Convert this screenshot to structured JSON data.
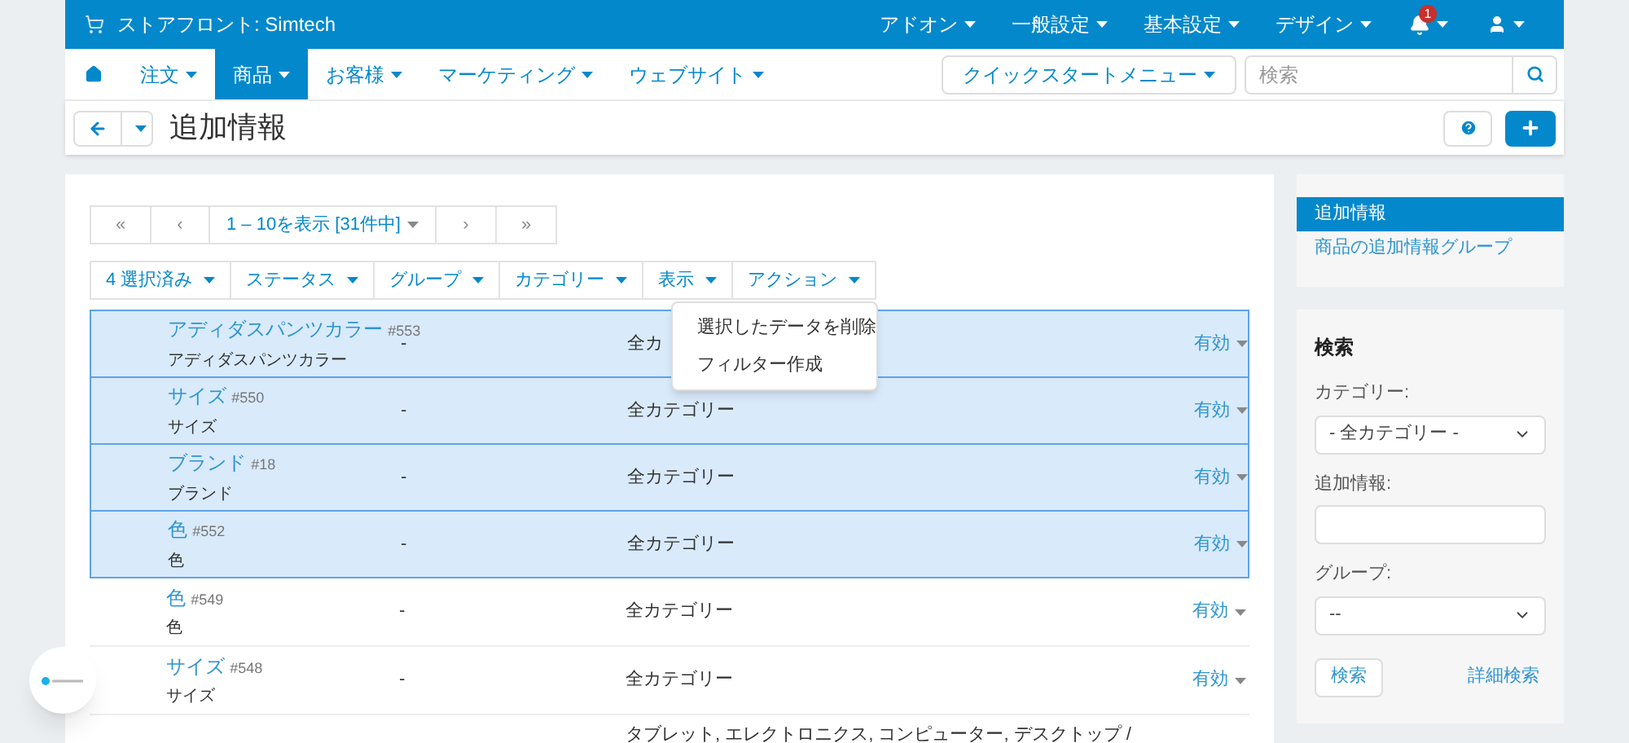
{
  "topbar": {
    "store": "ストアフロント: Simtech",
    "menus": [
      "アドオン",
      "一般設定",
      "基本設定",
      "デザイン"
    ],
    "notification_count": "1"
  },
  "nav": {
    "tabs": [
      {
        "label": "注文",
        "selected": false
      },
      {
        "label": "商品",
        "selected": true
      },
      {
        "label": "お客様",
        "selected": false
      },
      {
        "label": "マーケティング",
        "selected": false
      },
      {
        "label": "ウェブサイト",
        "selected": false
      }
    ],
    "quickstart": "クイックスタートメニュー",
    "search": {
      "placeholder": "検索"
    }
  },
  "page_title": "追加情報",
  "pagination": {
    "first": "«",
    "prev": "‹",
    "range": "1 – 10を表示 [31件中]",
    "next": "›",
    "last": "»"
  },
  "filters": [
    "4 選択済み",
    "ステータス",
    "グループ",
    "カテゴリー",
    "表示",
    "アクション"
  ],
  "action_menu": [
    "選択したデータを削除",
    "フィルター作成"
  ],
  "rows": [
    {
      "name": "アディダスパンツカラー",
      "id": "#553",
      "sub": "アディダスパンツカラー",
      "group": "-",
      "category": "全カ",
      "status": "有効",
      "selected": true
    },
    {
      "name": "サイズ",
      "id": "#550",
      "sub": "サイズ",
      "group": "-",
      "category": "全カテゴリー",
      "status": "有効",
      "selected": true
    },
    {
      "name": "ブランド",
      "id": "#18",
      "sub": "ブランド",
      "group": "-",
      "category": "全カテゴリー",
      "status": "有効",
      "selected": true
    },
    {
      "name": "色",
      "id": "#552",
      "sub": "色",
      "group": "-",
      "category": "全カテゴリー",
      "status": "有効",
      "selected": true
    },
    {
      "name": "色",
      "id": "#549",
      "sub": "色",
      "group": "-",
      "category": "全カテゴリー",
      "status": "有効",
      "selected": false
    },
    {
      "name": "サイズ",
      "id": "#548",
      "sub": "サイズ",
      "group": "-",
      "category": "全カテゴリー",
      "status": "有効",
      "selected": false
    }
  ],
  "partial_row": {
    "category": "タブレット, エレクトロニクス, コンピューター, デスクトップ /"
  },
  "sidebar": {
    "items": [
      {
        "label": "追加情報",
        "selected": true
      },
      {
        "label": "商品の追加情報グループ",
        "selected": false
      }
    ]
  },
  "search_panel": {
    "title": "検索",
    "category_label": "カテゴリー:",
    "category_value": "- 全カテゴリー -",
    "feature_label": "追加情報:",
    "group_label": "グループ:",
    "group_value": "--",
    "search_button": "検索",
    "advanced_link": "詳細検索"
  }
}
